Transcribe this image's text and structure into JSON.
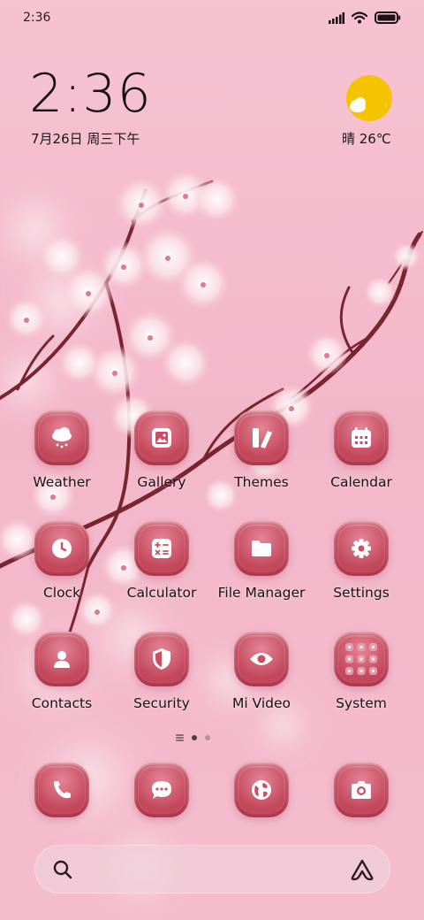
{
  "status_bar": {
    "time": "2:36",
    "icons": [
      "signal-icon",
      "wifi-icon",
      "battery-icon"
    ]
  },
  "clock_widget": {
    "time": "2:36",
    "date": "7月26日 周三下午"
  },
  "weather_widget": {
    "icon": "sun-cloud-icon",
    "text": "晴 26℃"
  },
  "apps": [
    {
      "label": "Weather",
      "icon": "cloud-rain-icon"
    },
    {
      "label": "Gallery",
      "icon": "image-icon"
    },
    {
      "label": "Themes",
      "icon": "palette-icon"
    },
    {
      "label": "Calendar",
      "icon": "calendar-icon"
    },
    {
      "label": "Clock",
      "icon": "clock-icon"
    },
    {
      "label": "Calculator",
      "icon": "calculator-icon"
    },
    {
      "label": "File Manager",
      "icon": "folder-icon"
    },
    {
      "label": "Settings",
      "icon": "gear-icon"
    },
    {
      "label": "Contacts",
      "icon": "person-icon"
    },
    {
      "label": "Security",
      "icon": "shield-icon"
    },
    {
      "label": "Mi Video",
      "icon": "eye-icon"
    },
    {
      "label": "System",
      "icon": "app-folder-icon"
    }
  ],
  "page_indicator": {
    "pages": 2,
    "active": 1
  },
  "dock": [
    {
      "icon": "phone-icon"
    },
    {
      "icon": "message-icon"
    },
    {
      "icon": "browser-icon"
    },
    {
      "icon": "camera-icon"
    }
  ],
  "search_bar": {
    "left_icon": "search-icon",
    "right_icon": "assistant-icon"
  },
  "colors": {
    "background": "#f4bccd",
    "icon_fill": "#c94f62",
    "text": "#1a1216",
    "sun": "#f5c400"
  }
}
